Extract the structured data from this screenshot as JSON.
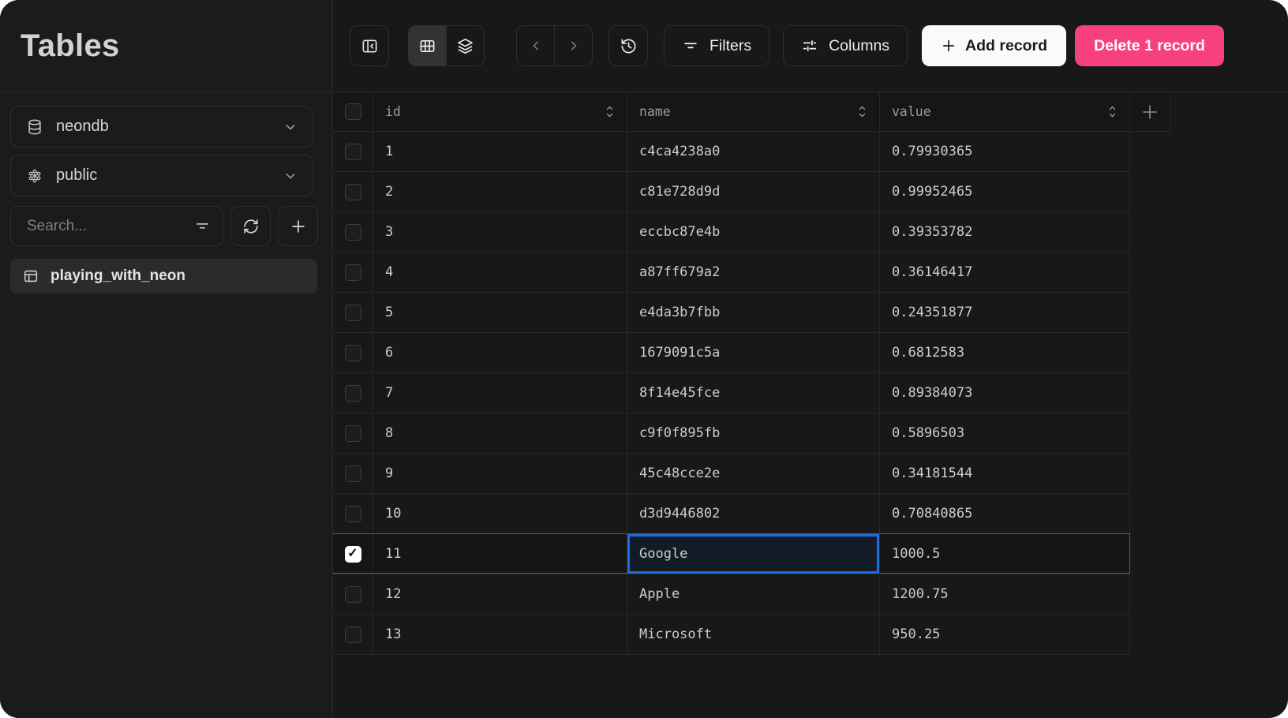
{
  "header": {
    "title": "Tables"
  },
  "colors": {
    "accent_blue": "#1a6ce0",
    "danger_pink": "#f7417c",
    "selected_cell_bg": "#131b27"
  },
  "icons": {
    "sidebar": [
      "database-icon",
      "schema-icon",
      "filter-icon",
      "refresh-icon",
      "plus-icon",
      "table-icon",
      "chevron-down-icon"
    ],
    "toolbar": [
      "panel-collapse-icon",
      "grid-view-icon",
      "layers-view-icon",
      "chevron-left-icon",
      "chevron-right-icon",
      "history-icon",
      "filter-lines-icon",
      "sliders-icon",
      "plus-icon"
    ],
    "grid": [
      "checkbox",
      "sort-icon",
      "plus-icon",
      "check-icon"
    ]
  },
  "sidebar": {
    "database_select": {
      "label": "neondb"
    },
    "schema_select": {
      "label": "public"
    },
    "search": {
      "placeholder": "Search..."
    },
    "tables": [
      {
        "label": "playing_with_neon",
        "selected": true
      }
    ]
  },
  "toolbar": {
    "filters_label": "Filters",
    "columns_label": "Columns",
    "add_record_label": "Add record",
    "delete_record_label": "Delete 1 record"
  },
  "table": {
    "columns": [
      {
        "label": "id",
        "sortable": true
      },
      {
        "label": "name",
        "sortable": true
      },
      {
        "label": "value",
        "sortable": true
      }
    ],
    "rows": [
      {
        "id": "1",
        "name": "c4ca4238a0",
        "value": "0.79930365",
        "checked": false,
        "selected": false,
        "selected_cell": null
      },
      {
        "id": "2",
        "name": "c81e728d9d",
        "value": "0.99952465",
        "checked": false,
        "selected": false,
        "selected_cell": null
      },
      {
        "id": "3",
        "name": "eccbc87e4b",
        "value": "0.39353782",
        "checked": false,
        "selected": false,
        "selected_cell": null
      },
      {
        "id": "4",
        "name": "a87ff679a2",
        "value": "0.36146417",
        "checked": false,
        "selected": false,
        "selected_cell": null
      },
      {
        "id": "5",
        "name": "e4da3b7fbb",
        "value": "0.24351877",
        "checked": false,
        "selected": false,
        "selected_cell": null
      },
      {
        "id": "6",
        "name": "1679091c5a",
        "value": "0.6812583",
        "checked": false,
        "selected": false,
        "selected_cell": null
      },
      {
        "id": "7",
        "name": "8f14e45fce",
        "value": "0.89384073",
        "checked": false,
        "selected": false,
        "selected_cell": null
      },
      {
        "id": "8",
        "name": "c9f0f895fb",
        "value": "0.5896503",
        "checked": false,
        "selected": false,
        "selected_cell": null
      },
      {
        "id": "9",
        "name": "45c48cce2e",
        "value": "0.34181544",
        "checked": false,
        "selected": false,
        "selected_cell": null
      },
      {
        "id": "10",
        "name": "d3d9446802",
        "value": "0.70840865",
        "checked": false,
        "selected": false,
        "selected_cell": null
      },
      {
        "id": "11",
        "name": "Google",
        "value": "1000.5",
        "checked": true,
        "selected": true,
        "selected_cell": "name"
      },
      {
        "id": "12",
        "name": "Apple",
        "value": "1200.75",
        "checked": false,
        "selected": false,
        "selected_cell": null
      },
      {
        "id": "13",
        "name": "Microsoft",
        "value": "950.25",
        "checked": false,
        "selected": false,
        "selected_cell": null
      }
    ]
  }
}
